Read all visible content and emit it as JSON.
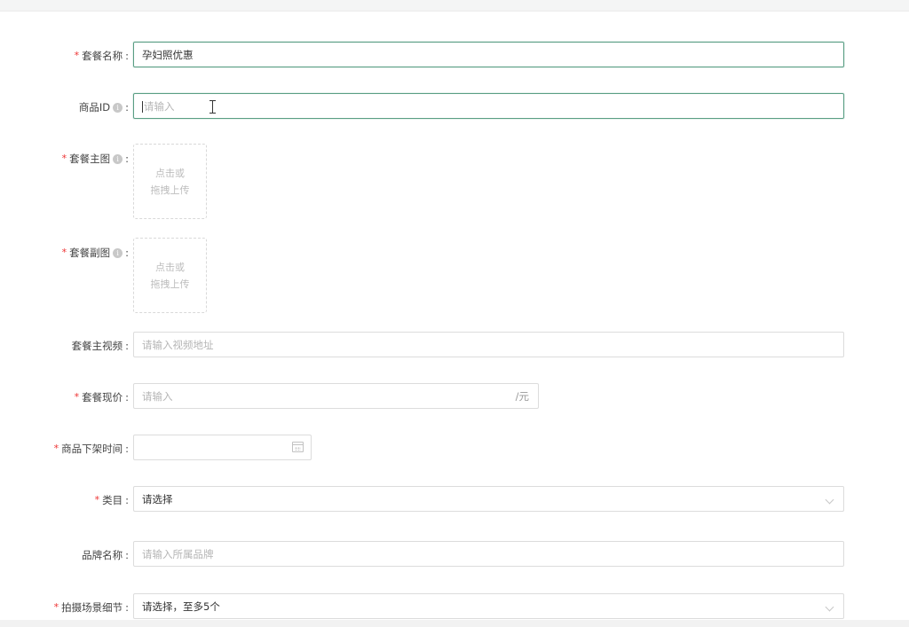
{
  "form": {
    "package_name": {
      "label": "套餐名称",
      "required": true,
      "value": "孕妇照优惠"
    },
    "product_id": {
      "label": "商品ID",
      "required": false,
      "placeholder": "请输入"
    },
    "main_image": {
      "label": "套餐主图",
      "required": true,
      "upload_line1": "点击或",
      "upload_line2": "拖拽上传"
    },
    "sub_image": {
      "label": "套餐副图",
      "required": true,
      "upload_line1": "点击或",
      "upload_line2": "拖拽上传"
    },
    "main_video": {
      "label": "套餐主视频",
      "required": false,
      "placeholder": "请输入视频地址"
    },
    "current_price": {
      "label": "套餐现价",
      "required": true,
      "placeholder": "请输入",
      "suffix": "/元"
    },
    "offline_time": {
      "label": "商品下架时间",
      "required": true
    },
    "category": {
      "label": "类目",
      "required": true,
      "placeholder": "请选择"
    },
    "brand_name": {
      "label": "品牌名称",
      "required": false,
      "placeholder": "请输入所属品牌"
    },
    "shooting_scene": {
      "label": "拍摄场景细节",
      "required": true,
      "placeholder": "请选择，至多5个"
    }
  },
  "colors": {
    "required": "#e33333",
    "focus_border": "#5a9e84"
  },
  "icons": {
    "info": "info-circle-icon",
    "calendar": "calendar-icon",
    "dropdown": "chevron-down-icon"
  }
}
